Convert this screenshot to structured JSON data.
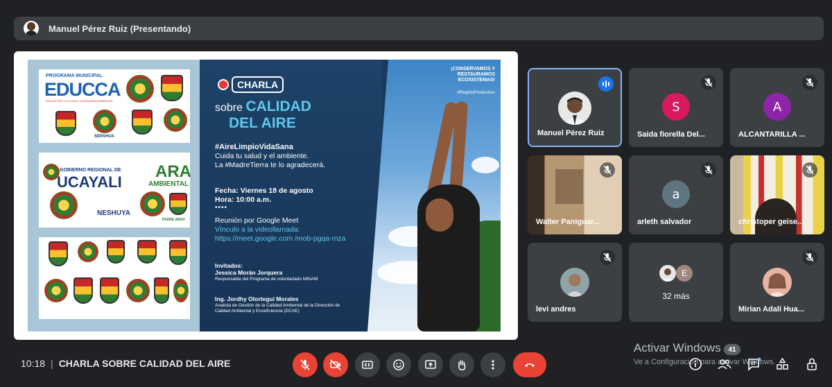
{
  "presenter": {
    "name": "Manuel Pérez Ruiz (Presentando)"
  },
  "slide": {
    "logos": {
      "educca_small": "PROGRAMA MUNICIPAL",
      "educca": "EDUCCA",
      "educca_sub": "EDUCACIÓN, CULTURA Y CIUDADANÍA AMBIENTAL",
      "sepahua": "SEPAHUA",
      "gob_small": "GOBIERNO REGIONAL DE",
      "ucayali": "UCAYALI",
      "ara": "ARA",
      "ara_sub": "AMBIENTAL",
      "neshuya": "NESHUYA",
      "padre": "PADRE ABAD"
    },
    "charla": "CHARLA",
    "sobre": "sobre",
    "calidad": "CALIDAD",
    "del_aire": "DEL AIRE",
    "hashtag": "#AireLimpioVidaSana",
    "line1": "Cuida tu salud y el ambiente.",
    "line2": "La #MadreTierra te lo agradecerá.",
    "fecha": "Fecha: Viernes 18 de agosto",
    "hora": "Hora: 10:00 a.m.",
    "dots": "••••",
    "reunion": "Reunión por Google Meet",
    "vinculo": "Vínculo a la videollamada: https://meet.google.com /mob-pgqa-mza",
    "invitados": "Invitados:",
    "guest1": "Jessica Morán Jorquera",
    "guest1_role": "Responsable del Programa de voluntariado MINAM",
    "guest2": "Ing. Jordhy Olortegui Morales",
    "guest2_role": "Analista de Gestión de la Calidad Ambiental de la Dirección de Calidad Ambiental y Ecoeficiencia (DCAE)",
    "tagline": "¡CONSERVAMOS Y RESTAURAMOS ECOSISTEMAS!",
    "tag_region": "#RegiónProductivo"
  },
  "participants": [
    {
      "name": "Manuel Pérez Ruiz",
      "speaking": true
    },
    {
      "name": "Saida fiorella Del...",
      "initial": "S",
      "color": "#d81b60"
    },
    {
      "name": "ALCANTARILLA ...",
      "initial": "A",
      "color": "#8e24aa"
    },
    {
      "name": "Walter Paniguar..."
    },
    {
      "name": "arleth salvador",
      "initial": "a",
      "color": "#5f7681"
    },
    {
      "name": "christoper geise..."
    },
    {
      "name": "levi andres"
    },
    {
      "name": "32 más",
      "initial": "E"
    },
    {
      "name": "Mirian Adalí Hua..."
    }
  ],
  "meeting": {
    "time": "10:18",
    "title": "CHARLA SOBRE CALIDAD DEL AIRE"
  },
  "windows": {
    "activate": "Activar Windows",
    "sub": "Ve a Configuración para activar Windows.",
    "badge": "41"
  },
  "colors": {
    "background": "#202124",
    "tile": "#3c4043",
    "red": "#ea4335",
    "accent": "#8ab4f8"
  }
}
